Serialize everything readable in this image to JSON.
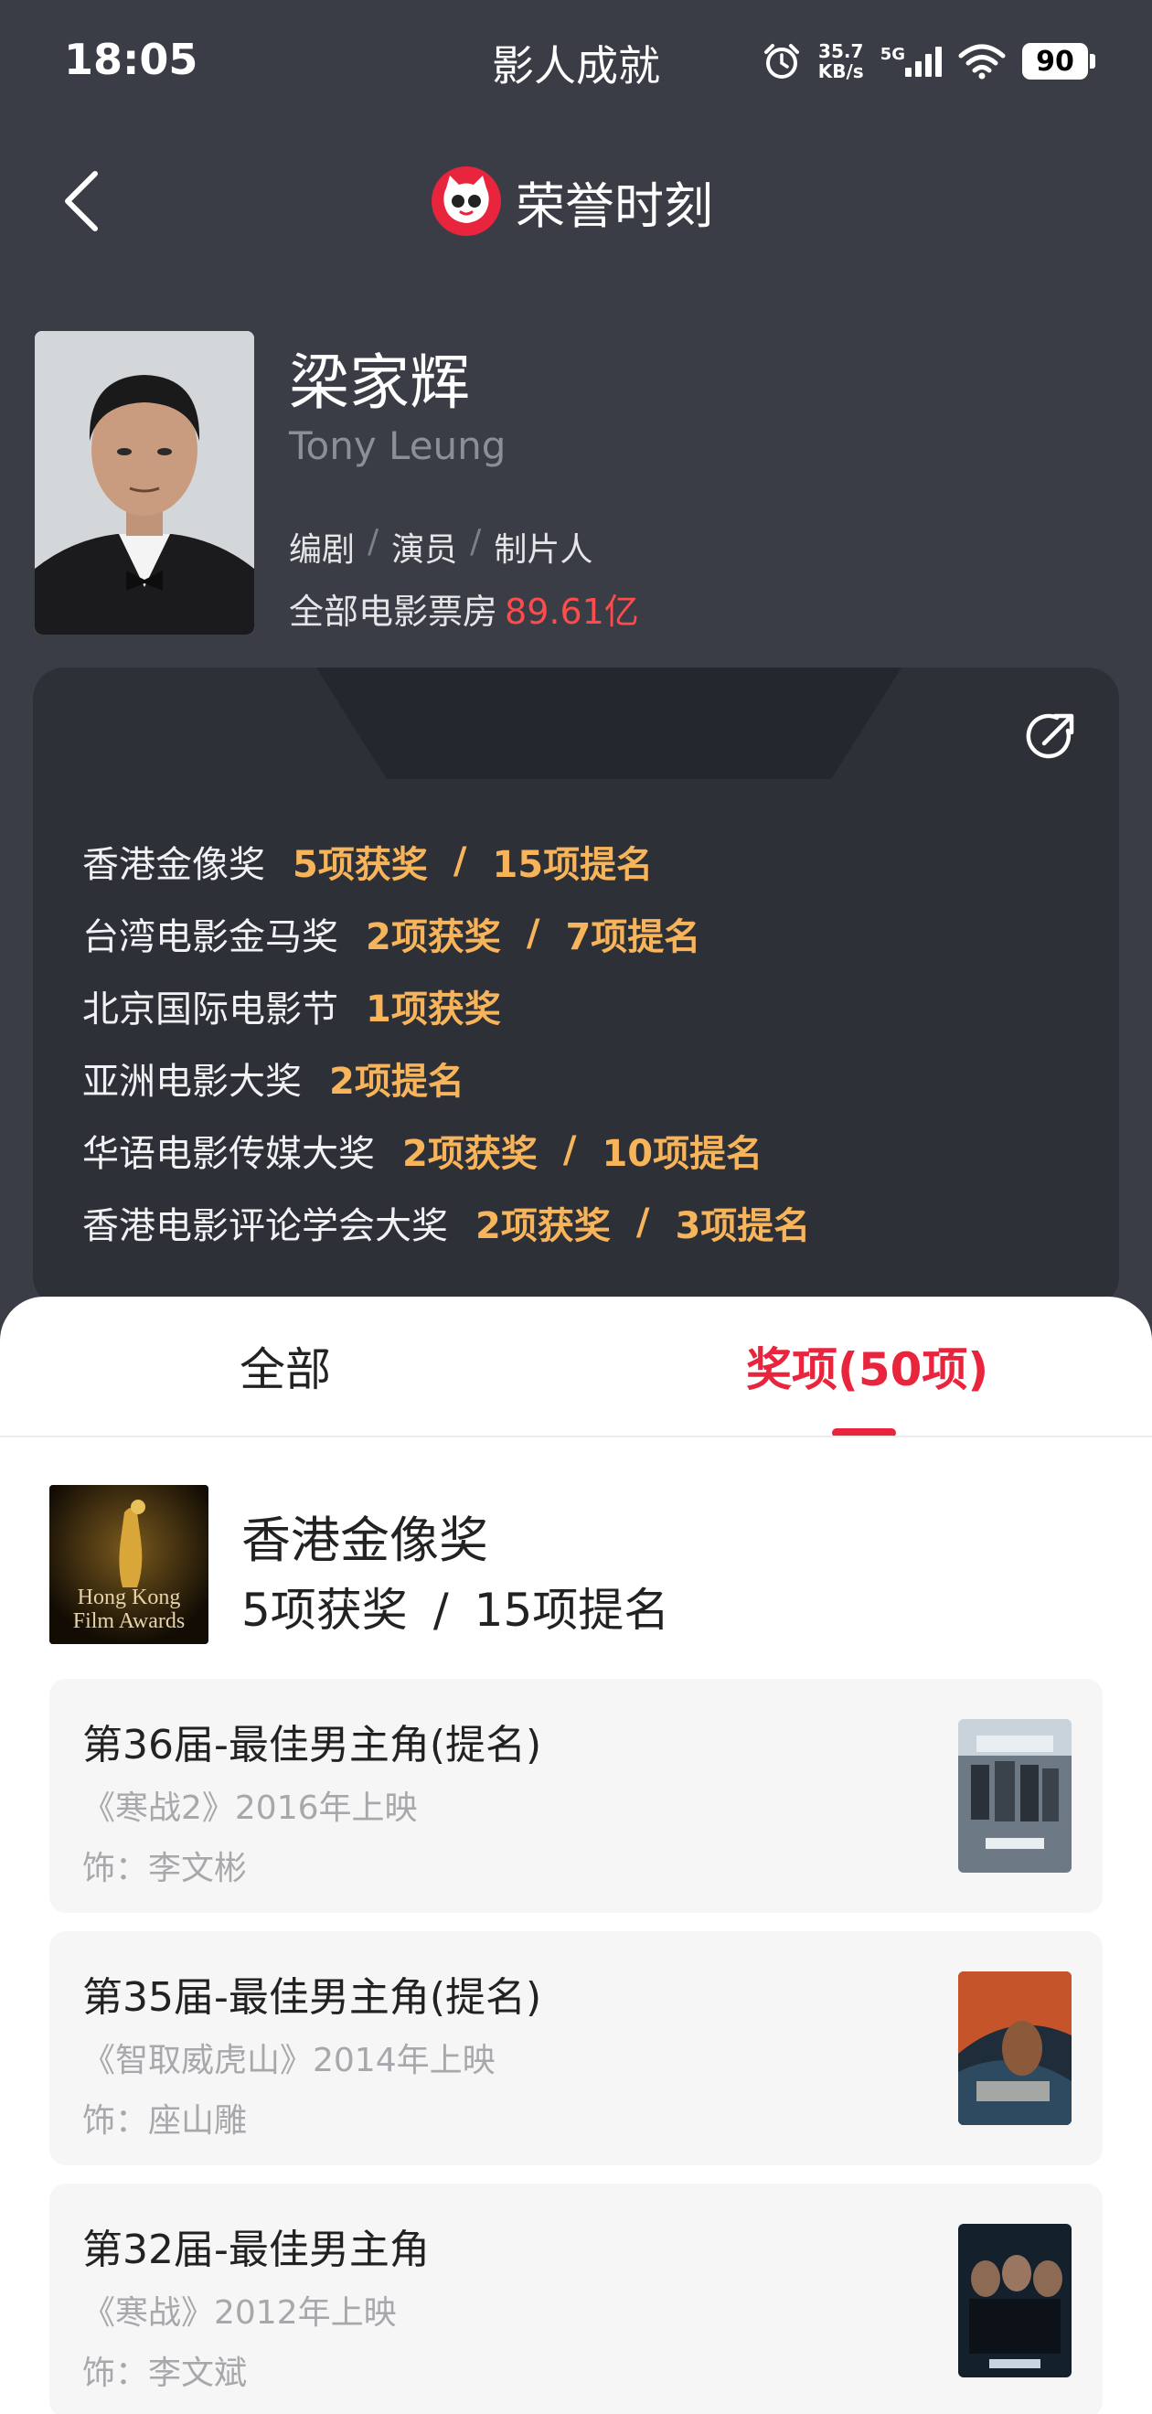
{
  "status_bar": {
    "time": "18:05",
    "net_speed": "35.7",
    "net_unit": "KB/s",
    "signal_label": "5G",
    "battery": "90"
  },
  "header": {
    "title": "荣誉时刻",
    "back_icon": "chevron-left-icon",
    "logo_icon": "cat-logo-icon"
  },
  "profile": {
    "name": "梁家辉",
    "english_name": "Tony Leung",
    "roles": [
      "编剧",
      "演员",
      "制片人"
    ],
    "role_separator": "/",
    "box_office_label": "全部电影票房",
    "box_office_value": "89.61亿"
  },
  "achievements": {
    "title": "影人成就",
    "items": [
      {
        "name": "香港金像奖",
        "wins": "5项获奖",
        "noms": "15项提名"
      },
      {
        "name": "台湾电影金马奖",
        "wins": "2项获奖",
        "noms": "7项提名"
      },
      {
        "name": "北京国际电影节",
        "wins": "1项获奖",
        "noms": ""
      },
      {
        "name": "亚洲电影大奖",
        "wins": "2项提名",
        "noms": ""
      },
      {
        "name": "华语电影传媒大奖",
        "wins": "2项获奖",
        "noms": "10项提名"
      },
      {
        "name": "香港电影评论学会大奖",
        "wins": "2项获奖",
        "noms": "3项提名"
      }
    ],
    "slash": "/"
  },
  "tabs": {
    "all": "全部",
    "awards": "奖项(50项)"
  },
  "ceremony": {
    "name": "香港金像奖",
    "wins": "5项获奖",
    "slash": "/",
    "noms": "15项提名",
    "logo_text_1": "Hong Kong",
    "logo_text_2": "Film Awards"
  },
  "awards": [
    {
      "title": "第36届-最佳男主角(提名)",
      "film": "《寒战2》2016年上映",
      "role": "饰：李文彬"
    },
    {
      "title": "第35届-最佳男主角(提名)",
      "film": "《智取威虎山》2014年上映",
      "role": "饰：座山雕"
    },
    {
      "title": "第32届-最佳男主角",
      "film": "《寒战》2012年上映",
      "role": "饰：李文斌"
    }
  ],
  "colors": {
    "accent_red": "#e8253d",
    "gold": "#f7b45a",
    "box_office_red": "#ff4b4b",
    "dark_bg": "#3a3d46"
  }
}
